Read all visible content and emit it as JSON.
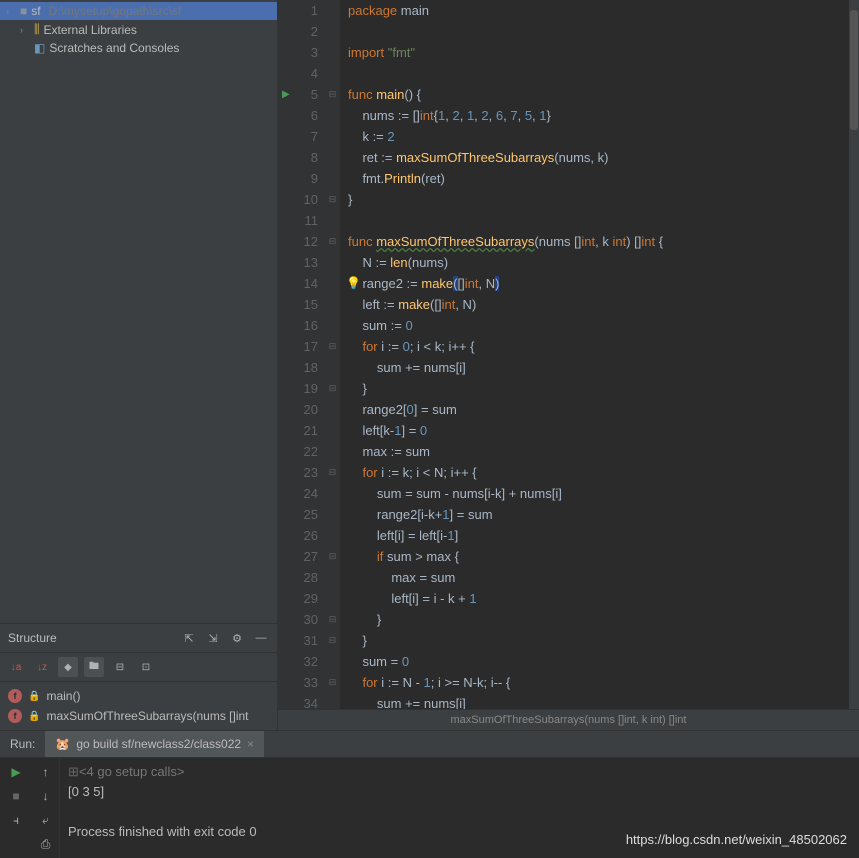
{
  "project": {
    "root": {
      "name": "sf",
      "path": "D:\\mysetup\\gopath\\src\\sf"
    },
    "libs": "External Libraries",
    "scratch": "Scratches and Consoles"
  },
  "structure": {
    "title": "Structure",
    "funcs": [
      {
        "name": "main()"
      },
      {
        "name": "maxSumOfThreeSubarrays(nums []int"
      }
    ]
  },
  "breadcrumb": "maxSumOfThreeSubarrays(nums []int, k int) []int",
  "code": {
    "lines": [
      {
        "n": 1,
        "tokens": [
          {
            "t": "package ",
            "c": "kw"
          },
          {
            "t": "main",
            "c": "id"
          }
        ]
      },
      {
        "n": 2,
        "tokens": []
      },
      {
        "n": 3,
        "tokens": [
          {
            "t": "import ",
            "c": "kw"
          },
          {
            "t": "\"fmt\"",
            "c": "str"
          }
        ]
      },
      {
        "n": 4,
        "tokens": []
      },
      {
        "n": 5,
        "run": true,
        "fold": "⊟",
        "tokens": [
          {
            "t": "func ",
            "c": "kw"
          },
          {
            "t": "main",
            "c": "fn"
          },
          {
            "t": "() {",
            "c": "pn"
          }
        ]
      },
      {
        "n": 6,
        "tokens": [
          {
            "t": "    nums ",
            "c": "id"
          },
          {
            "t": ":= ",
            "c": "op"
          },
          {
            "t": "[]",
            "c": "pn"
          },
          {
            "t": "int",
            "c": "typ"
          },
          {
            "t": "{",
            "c": "pn"
          },
          {
            "t": "1",
            "c": "num"
          },
          {
            "t": ", ",
            "c": "pn"
          },
          {
            "t": "2",
            "c": "num"
          },
          {
            "t": ", ",
            "c": "pn"
          },
          {
            "t": "1",
            "c": "num"
          },
          {
            "t": ", ",
            "c": "pn"
          },
          {
            "t": "2",
            "c": "num"
          },
          {
            "t": ", ",
            "c": "pn"
          },
          {
            "t": "6",
            "c": "num"
          },
          {
            "t": ", ",
            "c": "pn"
          },
          {
            "t": "7",
            "c": "num"
          },
          {
            "t": ", ",
            "c": "pn"
          },
          {
            "t": "5",
            "c": "num"
          },
          {
            "t": ", ",
            "c": "pn"
          },
          {
            "t": "1",
            "c": "num"
          },
          {
            "t": "}",
            "c": "pn"
          }
        ]
      },
      {
        "n": 7,
        "tokens": [
          {
            "t": "    k ",
            "c": "id"
          },
          {
            "t": ":= ",
            "c": "op"
          },
          {
            "t": "2",
            "c": "num"
          }
        ]
      },
      {
        "n": 8,
        "tokens": [
          {
            "t": "    ret ",
            "c": "id"
          },
          {
            "t": ":= ",
            "c": "op"
          },
          {
            "t": "maxSumOfThreeSubarrays",
            "c": "fn"
          },
          {
            "t": "(nums, k)",
            "c": "pn"
          }
        ]
      },
      {
        "n": 9,
        "tokens": [
          {
            "t": "    fmt",
            "c": "id"
          },
          {
            "t": ".",
            "c": "pn"
          },
          {
            "t": "Println",
            "c": "fn"
          },
          {
            "t": "(ret)",
            "c": "pn"
          }
        ]
      },
      {
        "n": 10,
        "fold": "⊟",
        "tokens": [
          {
            "t": "}",
            "c": "pn"
          }
        ]
      },
      {
        "n": 11,
        "tokens": []
      },
      {
        "n": 12,
        "fold": "⊟",
        "tokens": [
          {
            "t": "func ",
            "c": "kw"
          },
          {
            "t": "maxSumOfThreeSubarrays",
            "c": "fn wavy"
          },
          {
            "t": "(nums []",
            "c": "pn"
          },
          {
            "t": "int",
            "c": "typ"
          },
          {
            "t": ", k ",
            "c": "pn"
          },
          {
            "t": "int",
            "c": "typ"
          },
          {
            "t": ") []",
            "c": "pn"
          },
          {
            "t": "int",
            "c": "typ"
          },
          {
            "t": " {",
            "c": "pn"
          }
        ]
      },
      {
        "n": 13,
        "tokens": [
          {
            "t": "    N ",
            "c": "id"
          },
          {
            "t": ":= ",
            "c": "op"
          },
          {
            "t": "len",
            "c": "fn"
          },
          {
            "t": "(nums)",
            "c": "pn"
          }
        ]
      },
      {
        "n": 14,
        "bulb": true,
        "tokens": [
          {
            "t": "    range2 ",
            "c": "id"
          },
          {
            "t": ":= ",
            "c": "op"
          },
          {
            "t": "make",
            "c": "fn"
          },
          {
            "t": "(",
            "c": "pn hl"
          },
          {
            "t": "[]",
            "c": "pn"
          },
          {
            "t": "int",
            "c": "typ"
          },
          {
            "t": ", N",
            "c": "pn"
          },
          {
            "t": ")",
            "c": "pn hl"
          }
        ]
      },
      {
        "n": 15,
        "tokens": [
          {
            "t": "    left ",
            "c": "id"
          },
          {
            "t": ":= ",
            "c": "op"
          },
          {
            "t": "make",
            "c": "fn"
          },
          {
            "t": "([]",
            "c": "pn"
          },
          {
            "t": "int",
            "c": "typ"
          },
          {
            "t": ", N)",
            "c": "pn"
          }
        ]
      },
      {
        "n": 16,
        "tokens": [
          {
            "t": "    sum ",
            "c": "id"
          },
          {
            "t": ":= ",
            "c": "op"
          },
          {
            "t": "0",
            "c": "num"
          }
        ]
      },
      {
        "n": 17,
        "fold": "⊟",
        "tokens": [
          {
            "t": "    ",
            "c": "pn"
          },
          {
            "t": "for ",
            "c": "kw"
          },
          {
            "t": "i ",
            "c": "id"
          },
          {
            "t": ":= ",
            "c": "op"
          },
          {
            "t": "0",
            "c": "num"
          },
          {
            "t": "; i < k; i++ {",
            "c": "pn"
          }
        ]
      },
      {
        "n": 18,
        "tokens": [
          {
            "t": "        sum += nums[i]",
            "c": "id"
          }
        ]
      },
      {
        "n": 19,
        "fold": "⊟",
        "tokens": [
          {
            "t": "    }",
            "c": "pn"
          }
        ]
      },
      {
        "n": 20,
        "tokens": [
          {
            "t": "    range2[",
            "c": "id"
          },
          {
            "t": "0",
            "c": "num"
          },
          {
            "t": "] = sum",
            "c": "id"
          }
        ]
      },
      {
        "n": 21,
        "tokens": [
          {
            "t": "    left[k-",
            "c": "id"
          },
          {
            "t": "1",
            "c": "num"
          },
          {
            "t": "] = ",
            "c": "id"
          },
          {
            "t": "0",
            "c": "num"
          }
        ]
      },
      {
        "n": 22,
        "tokens": [
          {
            "t": "    max ",
            "c": "id"
          },
          {
            "t": ":= ",
            "c": "op"
          },
          {
            "t": "sum",
            "c": "id"
          }
        ]
      },
      {
        "n": 23,
        "fold": "⊟",
        "tokens": [
          {
            "t": "    ",
            "c": "pn"
          },
          {
            "t": "for ",
            "c": "kw"
          },
          {
            "t": "i ",
            "c": "id"
          },
          {
            "t": ":= ",
            "c": "op"
          },
          {
            "t": "k; i < N; i++ {",
            "c": "id"
          }
        ]
      },
      {
        "n": 24,
        "tokens": [
          {
            "t": "        sum = sum - nums[i-k] + nums[i]",
            "c": "id"
          }
        ]
      },
      {
        "n": 25,
        "tokens": [
          {
            "t": "        range2[i-k+",
            "c": "id"
          },
          {
            "t": "1",
            "c": "num"
          },
          {
            "t": "] = sum",
            "c": "id"
          }
        ]
      },
      {
        "n": 26,
        "tokens": [
          {
            "t": "        left[i] = left[i-",
            "c": "id"
          },
          {
            "t": "1",
            "c": "num"
          },
          {
            "t": "]",
            "c": "id"
          }
        ]
      },
      {
        "n": 27,
        "fold": "⊟",
        "tokens": [
          {
            "t": "        ",
            "c": "pn"
          },
          {
            "t": "if ",
            "c": "kw"
          },
          {
            "t": "sum > max {",
            "c": "id"
          }
        ]
      },
      {
        "n": 28,
        "tokens": [
          {
            "t": "            max = sum",
            "c": "id"
          }
        ]
      },
      {
        "n": 29,
        "tokens": [
          {
            "t": "            left[i] = i - k + ",
            "c": "id"
          },
          {
            "t": "1",
            "c": "num"
          }
        ]
      },
      {
        "n": 30,
        "fold": "⊟",
        "tokens": [
          {
            "t": "        }",
            "c": "pn"
          }
        ]
      },
      {
        "n": 31,
        "fold": "⊟",
        "tokens": [
          {
            "t": "    }",
            "c": "pn"
          }
        ]
      },
      {
        "n": 32,
        "tokens": [
          {
            "t": "    sum = ",
            "c": "id"
          },
          {
            "t": "0",
            "c": "num"
          }
        ]
      },
      {
        "n": 33,
        "fold": "⊟",
        "tokens": [
          {
            "t": "    ",
            "c": "pn"
          },
          {
            "t": "for ",
            "c": "kw"
          },
          {
            "t": "i ",
            "c": "id"
          },
          {
            "t": ":= ",
            "c": "op"
          },
          {
            "t": "N - ",
            "c": "id"
          },
          {
            "t": "1",
            "c": "num"
          },
          {
            "t": "; i >= N-k; i-- {",
            "c": "id"
          }
        ]
      },
      {
        "n": 34,
        "tokens": [
          {
            "t": "        sum += nums[i]",
            "c": "id"
          }
        ]
      }
    ]
  },
  "run": {
    "label": "Run:",
    "tab": "go build sf/newclass2/class022",
    "output": {
      "setup": "<4 go setup calls>",
      "result": "[0 3 5]",
      "exit": "Process finished with exit code 0"
    }
  },
  "watermark": "https://blog.csdn.net/weixin_48502062"
}
